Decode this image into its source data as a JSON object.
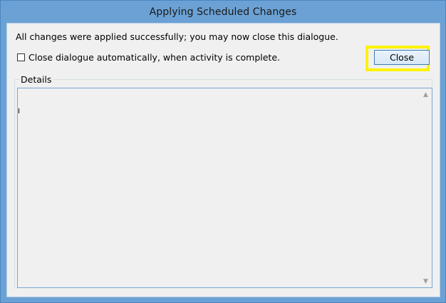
{
  "window": {
    "title": "Applying Scheduled Changes"
  },
  "dialog": {
    "message": "All changes were applied successfully; you may now close this dialogue.",
    "auto_close_label": "Close dialogue automatically, when activity is complete.",
    "auto_close_checked": false,
    "close_label": "Close",
    "details_label": "Details",
    "details_content": ""
  },
  "icons": {
    "scroll_up": "chevron-up-icon",
    "scroll_down": "chevron-down-icon"
  },
  "colors": {
    "title_bar": "#6ba1d4",
    "highlight": "#fef200",
    "button_border": "#3c7fb1"
  }
}
